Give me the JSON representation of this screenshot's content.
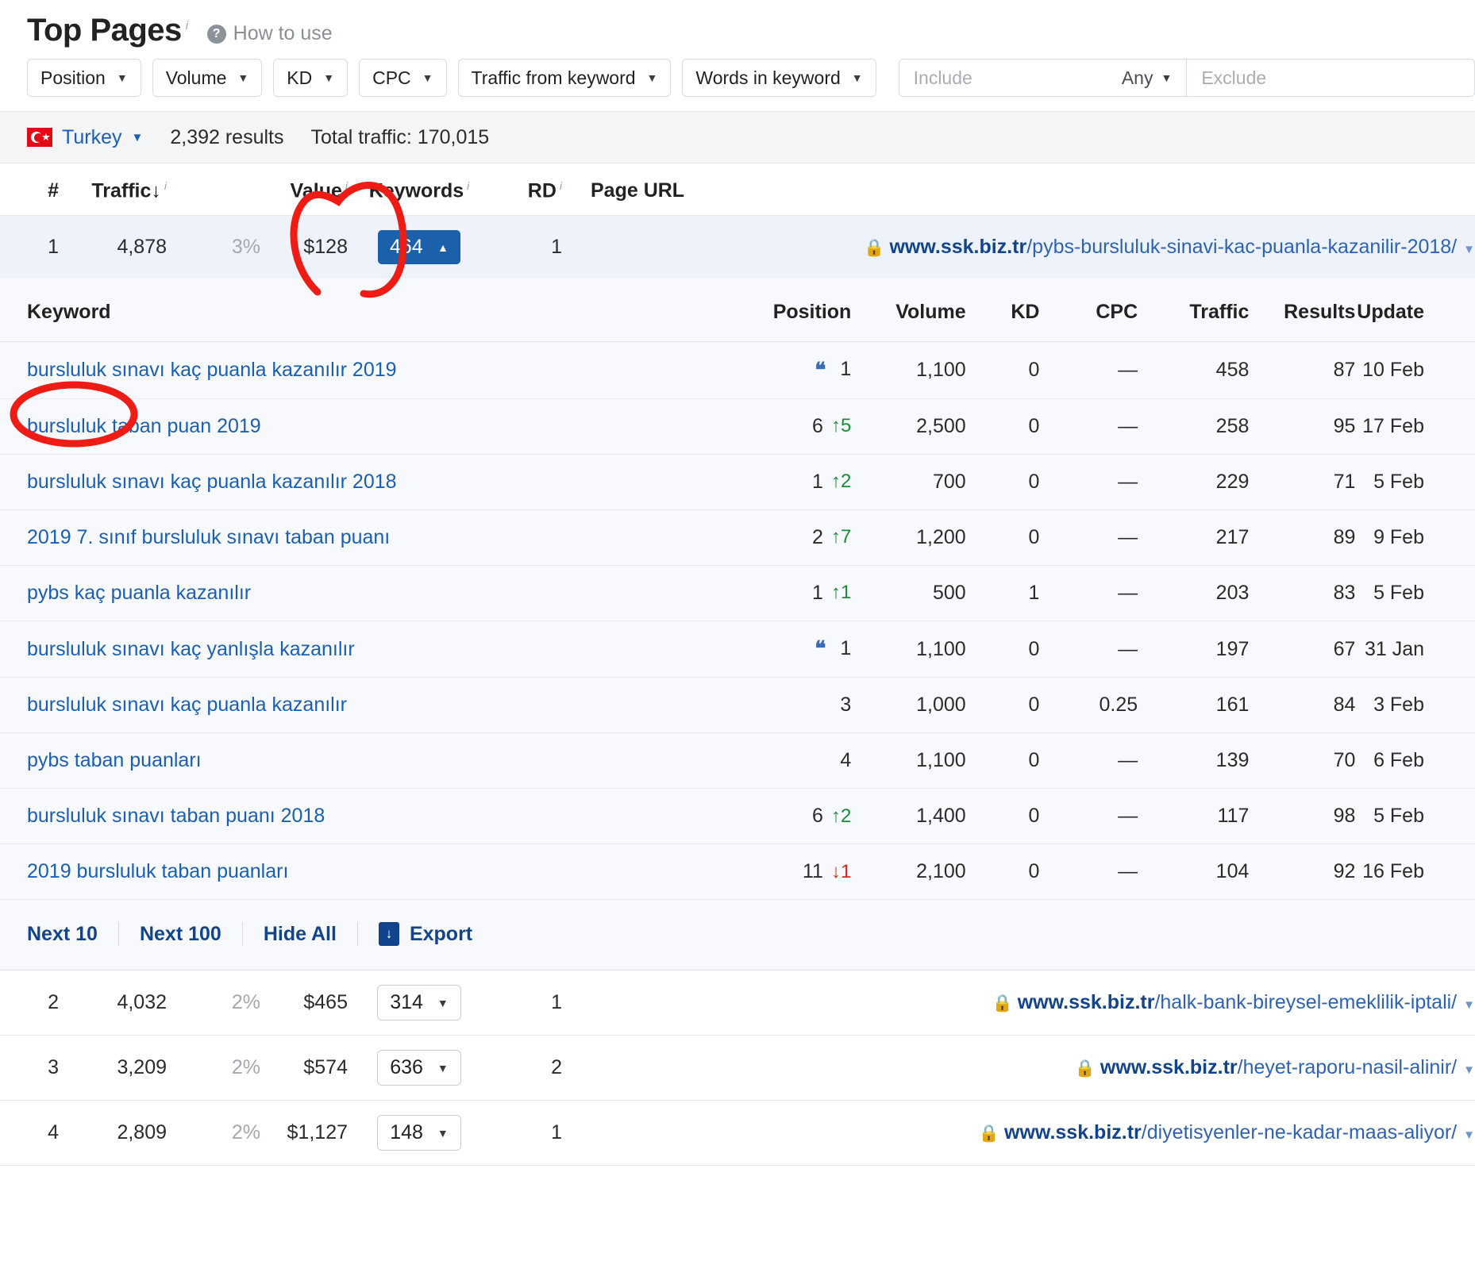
{
  "header": {
    "title": "Top Pages",
    "title_info": "i",
    "help_icon": "question-icon",
    "help_label": "How to use"
  },
  "filters": {
    "buttons": [
      {
        "label": "Position"
      },
      {
        "label": "Volume"
      },
      {
        "label": "KD"
      },
      {
        "label": "CPC"
      },
      {
        "label": "Traffic from keyword"
      },
      {
        "label": "Words in keyword"
      }
    ],
    "include_placeholder": "Include",
    "include_mode": "Any",
    "exclude_placeholder": "Exclude"
  },
  "summary": {
    "country": "Turkey",
    "results": "2,392 results",
    "total_traffic": "Total traffic: 170,015"
  },
  "main_table": {
    "columns": {
      "num": "#",
      "traffic": "Traffic",
      "sort_arrow": "↓",
      "value": "Value",
      "keywords": "Keywords",
      "rd": "RD",
      "page_url": "Page URL"
    },
    "rows": [
      {
        "num": "1",
        "traffic": "4,878",
        "pct": "3%",
        "value": "$128",
        "keywords": "464",
        "keywords_state": "expanded",
        "rd": "1",
        "domain": "www.ssk.biz.tr",
        "path": "/pybs-bursluluk-sinavi-kac-puanla-kazanilir-2018/"
      },
      {
        "num": "2",
        "traffic": "4,032",
        "pct": "2%",
        "value": "$465",
        "keywords": "314",
        "keywords_state": "collapsed",
        "rd": "1",
        "domain": "www.ssk.biz.tr",
        "path": "/halk-bank-bireysel-emeklilik-iptali/"
      },
      {
        "num": "3",
        "traffic": "3,209",
        "pct": "2%",
        "value": "$574",
        "keywords": "636",
        "keywords_state": "collapsed",
        "rd": "2",
        "domain": "www.ssk.biz.tr",
        "path": "/heyet-raporu-nasil-alinir/"
      },
      {
        "num": "4",
        "traffic": "2,809",
        "pct": "2%",
        "value": "$1,127",
        "keywords": "148",
        "keywords_state": "collapsed",
        "rd": "1",
        "domain": "www.ssk.biz.tr",
        "path": "/diyetisyenler-ne-kadar-maas-aliyor/"
      }
    ]
  },
  "keyword_panel": {
    "columns": {
      "keyword": "Keyword",
      "position": "Position",
      "volume": "Volume",
      "kd": "KD",
      "cpc": "CPC",
      "traffic": "Traffic",
      "results": "Results",
      "update": "Update"
    },
    "rows": [
      {
        "keyword": "bursluluk sınavı kaç puanla kazanılır 2019",
        "snippet": true,
        "position": "1",
        "change": "",
        "change_dir": "",
        "volume": "1,100",
        "kd": "0",
        "cpc": "—",
        "traffic": "458",
        "results": "87",
        "update": "10 Feb"
      },
      {
        "keyword": "bursluluk taban puan 2019",
        "snippet": false,
        "position": "6",
        "change": "5",
        "change_dir": "up",
        "volume": "2,500",
        "kd": "0",
        "cpc": "—",
        "traffic": "258",
        "results": "95",
        "update": "17 Feb"
      },
      {
        "keyword": "bursluluk sınavı kaç puanla kazanılır 2018",
        "snippet": false,
        "position": "1",
        "change": "2",
        "change_dir": "up",
        "volume": "700",
        "kd": "0",
        "cpc": "—",
        "traffic": "229",
        "results": "71",
        "update": "5 Feb"
      },
      {
        "keyword": "2019 7. sınıf bursluluk sınavı taban puanı",
        "snippet": false,
        "position": "2",
        "change": "7",
        "change_dir": "up",
        "volume": "1,200",
        "kd": "0",
        "cpc": "—",
        "traffic": "217",
        "results": "89",
        "update": "9 Feb"
      },
      {
        "keyword": "pybs kaç puanla kazanılır",
        "snippet": false,
        "position": "1",
        "change": "1",
        "change_dir": "up",
        "volume": "500",
        "kd": "1",
        "cpc": "—",
        "traffic": "203",
        "results": "83",
        "update": "5 Feb"
      },
      {
        "keyword": "bursluluk sınavı kaç yanlışla kazanılır",
        "snippet": true,
        "position": "1",
        "change": "",
        "change_dir": "",
        "volume": "1,100",
        "kd": "0",
        "cpc": "—",
        "traffic": "197",
        "results": "67",
        "update": "31 Jan"
      },
      {
        "keyword": "bursluluk sınavı kaç puanla kazanılır",
        "snippet": false,
        "position": "3",
        "change": "",
        "change_dir": "",
        "volume": "1,000",
        "kd": "0",
        "cpc": "0.25",
        "traffic": "161",
        "results": "84",
        "update": "3 Feb"
      },
      {
        "keyword": "pybs taban puanları",
        "snippet": false,
        "position": "4",
        "change": "",
        "change_dir": "",
        "volume": "1,100",
        "kd": "0",
        "cpc": "—",
        "traffic": "139",
        "results": "70",
        "update": "6 Feb"
      },
      {
        "keyword": "bursluluk sınavı taban puanı 2018",
        "snippet": false,
        "position": "6",
        "change": "2",
        "change_dir": "up",
        "volume": "1,400",
        "kd": "0",
        "cpc": "—",
        "traffic": "117",
        "results": "98",
        "update": "5 Feb"
      },
      {
        "keyword": "2019 bursluluk taban puanları",
        "snippet": false,
        "position": "11",
        "change": "1",
        "change_dir": "down",
        "volume": "2,100",
        "kd": "0",
        "cpc": "—",
        "traffic": "104",
        "results": "92",
        "update": "16 Feb"
      }
    ],
    "footer": {
      "next10": "Next 10",
      "next100": "Next 100",
      "hide_all": "Hide All",
      "export": "Export",
      "export_icon": "download-icon"
    }
  },
  "annotations": {
    "color": "#ee1c15",
    "shapes": [
      "keywords-column-circle",
      "keyword-header-circle"
    ]
  }
}
